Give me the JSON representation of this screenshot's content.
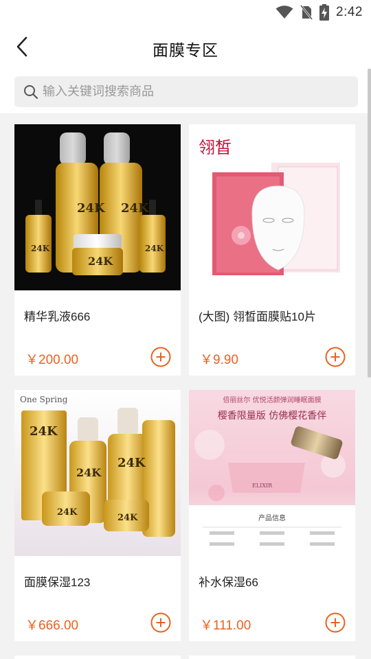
{
  "status_bar": {
    "time": "2:42",
    "icons": [
      "wifi-icon",
      "no-sim-icon",
      "battery-charging-icon"
    ]
  },
  "header": {
    "title": "面膜专区",
    "back_icon": "chevron-left-icon"
  },
  "search": {
    "placeholder": "输入关键词搜索商品",
    "value": ""
  },
  "colors": {
    "price": "#e8621f",
    "add_button": "#e8621f",
    "background": "#f2f2f2"
  },
  "products": [
    {
      "name": "精华乳液666",
      "price": "￥200.00",
      "image": "gold-serum-set"
    },
    {
      "name": "(大图) 翎皙面膜贴10片",
      "price": "￥9.90",
      "image": "pink-sheet-mask-box"
    },
    {
      "name": "面膜保湿123",
      "price": "￥666.00",
      "image": "gold-serum-collection"
    },
    {
      "name": "补水保湿66",
      "price": "￥111.00",
      "image": "cherry-blossom-cream-jar"
    }
  ],
  "product_images": {
    "gold_serum_set": {
      "label": "24K"
    },
    "pink_sheet_mask": {
      "brand": "翎皙"
    },
    "gold_collection": {
      "brand": "One Spring",
      "label": "24K"
    },
    "cherry_cream": {
      "headline": "樱香限量版 仿佛樱花香伴",
      "subhead": "倍丽丝尔 优悦活颜弹润睡眠面膜",
      "info_title": "产品信息"
    }
  }
}
